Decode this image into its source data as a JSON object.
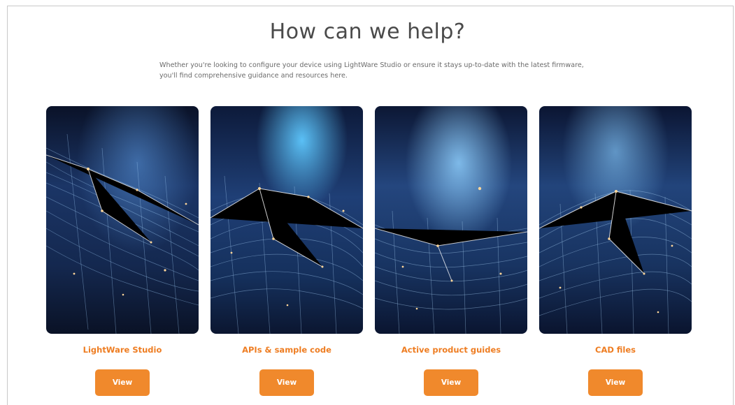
{
  "header": {
    "title": "How can we help?",
    "subtitle": "Whether you're looking to configure your device using LightWare Studio or ensure it stays up-to-date with the latest firmware, you'll find comprehensive guidance and resources here."
  },
  "cards": [
    {
      "label": "LightWare Studio",
      "button": "View",
      "image_icon": "network-mesh-image"
    },
    {
      "label": "APIs & sample code",
      "button": "View",
      "image_icon": "network-mesh-image"
    },
    {
      "label": "Active product guides",
      "button": "View",
      "image_icon": "network-mesh-image"
    },
    {
      "label": "CAD files",
      "button": "View",
      "image_icon": "network-mesh-image"
    }
  ],
  "colors": {
    "accent": "#f0892c",
    "label": "#ee7d22",
    "title": "#4a4a4a",
    "image_dark": "#0b1530",
    "image_mid": "#1d3a6e",
    "glow": "#5fb8ff"
  }
}
